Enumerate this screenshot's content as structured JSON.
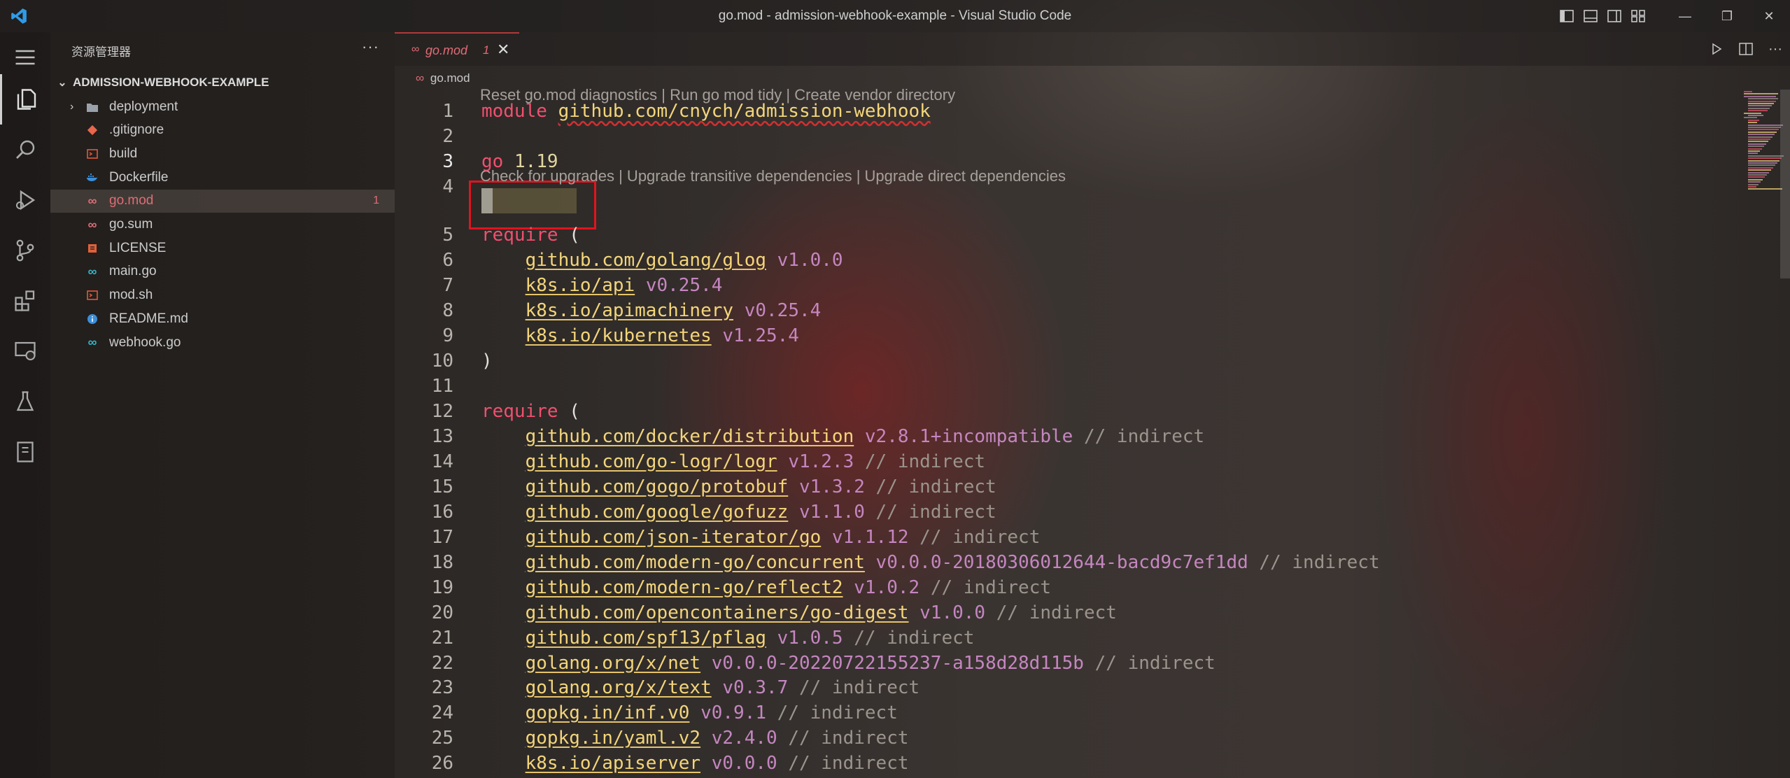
{
  "window": {
    "title": "go.mod - admission-webhook-example - Visual Studio Code"
  },
  "titlebar": {
    "layout_icons": [
      "toggle-primary-sidebar-icon",
      "toggle-panel-icon",
      "toggle-secondary-sidebar-icon",
      "customize-layout-icon"
    ],
    "window_controls": {
      "minimize": "—",
      "maximize": "❐",
      "close": "✕"
    }
  },
  "activitybar": {
    "items": [
      "explorer-icon",
      "search-icon",
      "run-debug-icon",
      "source-control-icon",
      "extensions-icon",
      "remote-explorer-icon",
      "testing-icon",
      "notebook-icon"
    ]
  },
  "sidebar": {
    "header": "资源管理器",
    "more": "···",
    "root": {
      "label": "ADMISSION-WEBHOOK-EXAMPLE",
      "chevron": "⌄"
    },
    "items": [
      {
        "label": "deployment",
        "icon": "folder-icon",
        "icon_color": "#9aa1aa",
        "type": "folder"
      },
      {
        "label": ".gitignore",
        "icon": "git-icon",
        "icon_color": "#e8674d"
      },
      {
        "label": "build",
        "icon": "terminal-file-icon",
        "icon_color": "#e05a3a"
      },
      {
        "label": "Dockerfile",
        "icon": "docker-icon",
        "icon_color": "#3b8fd9"
      },
      {
        "label": "go.mod",
        "icon": "go-mod-icon",
        "icon_color": "#e06c75",
        "badge": "1",
        "active": true
      },
      {
        "label": "go.sum",
        "icon": "go-mod-icon",
        "icon_color": "#e06c75"
      },
      {
        "label": "LICENSE",
        "icon": "license-icon",
        "icon_color": "#e0603a"
      },
      {
        "label": "main.go",
        "icon": "go-file-icon",
        "icon_color": "#33b5c6"
      },
      {
        "label": "mod.sh",
        "icon": "terminal-file-icon",
        "icon_color": "#e05a3a"
      },
      {
        "label": "README.md",
        "icon": "info-icon",
        "icon_color": "#3b8fd9"
      },
      {
        "label": "webhook.go",
        "icon": "go-file-icon",
        "icon_color": "#33b5c6"
      }
    ]
  },
  "editor": {
    "tab": {
      "label": "go.mod",
      "count": "1",
      "close": "✕",
      "icon": "∞"
    },
    "actions": [
      "run-icon",
      "split-editor-icon",
      "more-actions-icon"
    ],
    "breadcrumb": {
      "icon": "∞",
      "label": "go.mod"
    },
    "code_lens_top": "Reset go.mod diagnostics | Run go mod tidy | Create vendor directory",
    "code_lens_require": "Check for upgrades | Upgrade transitive dependencies | Upgrade direct dependencies",
    "line_numbers": [
      "1",
      "2",
      "3",
      "4",
      "5",
      "6",
      "7",
      "8",
      "9",
      "10",
      "11",
      "12",
      "13",
      "14",
      "15",
      "16",
      "17",
      "18",
      "19",
      "20",
      "21",
      "22",
      "23",
      "24",
      "25",
      "26"
    ],
    "lines": {
      "l1": {
        "kw": "module",
        "mod": "github.com/cnych/admission-webhook"
      },
      "l3": {
        "kw": "go",
        "ver": "1.19"
      },
      "l5": {
        "kw": "require",
        "paren": "("
      },
      "l6": {
        "mod": "github.com/golang/glog",
        "ver": "v1.0.0"
      },
      "l7": {
        "mod": "k8s.io/api",
        "ver": "v0.25.4"
      },
      "l8": {
        "mod": "k8s.io/apimachinery",
        "ver": "v0.25.4"
      },
      "l9": {
        "mod": "k8s.io/kubernetes",
        "ver": "v1.25.4"
      },
      "l10": {
        "paren": ")"
      },
      "l12": {
        "kw": "require",
        "paren": "("
      },
      "l13": {
        "mod": "github.com/docker/distribution",
        "ver": "v2.8.1+incompatible",
        "cmt": "// indirect"
      },
      "l14": {
        "mod": "github.com/go-logr/logr",
        "ver": "v1.2.3",
        "cmt": "// indirect"
      },
      "l15": {
        "mod": "github.com/gogo/protobuf",
        "ver": "v1.3.2",
        "cmt": "// indirect"
      },
      "l16": {
        "mod": "github.com/google/gofuzz",
        "ver": "v1.1.0",
        "cmt": "// indirect"
      },
      "l17": {
        "mod": "github.com/json-iterator/go",
        "ver": "v1.1.12",
        "cmt": "// indirect"
      },
      "l18": {
        "mod": "github.com/modern-go/concurrent",
        "ver": "v0.0.0-20180306012644-bacd9c7ef1dd",
        "cmt": "// indirect"
      },
      "l19": {
        "mod": "github.com/modern-go/reflect2",
        "ver": "v1.0.2",
        "cmt": "// indirect"
      },
      "l20": {
        "mod": "github.com/opencontainers/go-digest",
        "ver": "v1.0.0",
        "cmt": "// indirect"
      },
      "l21": {
        "mod": "github.com/spf13/pflag",
        "ver": "v1.0.5",
        "cmt": "// indirect"
      },
      "l22": {
        "mod": "golang.org/x/net",
        "ver": "v0.0.0-20220722155237-a158d28d115b",
        "cmt": "// indirect"
      },
      "l23": {
        "mod": "golang.org/x/text",
        "ver": "v0.3.7",
        "cmt": "// indirect"
      },
      "l24": {
        "mod": "gopkg.in/inf.v0",
        "ver": "v0.9.1",
        "cmt": "// indirect"
      },
      "l25": {
        "mod": "gopkg.in/yaml.v2",
        "ver": "v2.4.0",
        "cmt": "// indirect"
      },
      "l26": {
        "mod": "k8s.io/apiserver",
        "ver": "v0.0.0",
        "cmt": "// indirect"
      }
    }
  },
  "colors": {
    "keyword": "#f0506e",
    "module": "#f3d57a",
    "version": "#c586c0",
    "comment": "#9b948c",
    "highlight_box": "#e0141e"
  }
}
